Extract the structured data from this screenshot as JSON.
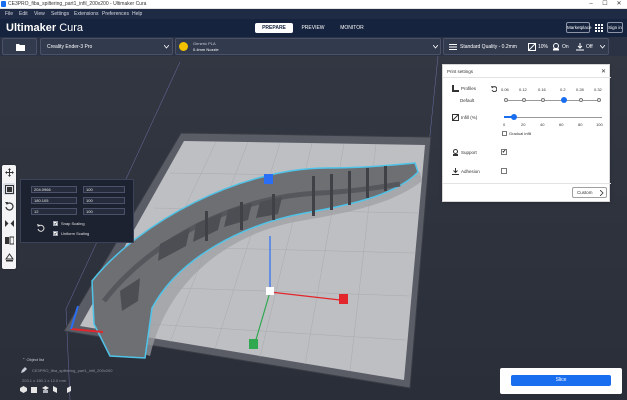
{
  "window": {
    "title": "CE3PRO_fiba_spiltering_part1_infil_200x200 - Ultimaker Cura",
    "controls": [
      "–",
      "☐",
      "✕"
    ]
  },
  "menu": [
    "File",
    "Edit",
    "View",
    "Settings",
    "Extensions",
    "Preferences",
    "Help"
  ],
  "header": {
    "logo_bold": "Ultimaker",
    "logo_light": "Cura",
    "stages": [
      "PREPARE",
      "PREVIEW",
      "MONITOR"
    ],
    "marketplace": "Marketplace",
    "signin": "Sign in"
  },
  "machine": {
    "printer": "Creality Ender-3 Pro",
    "material_brand": "Generic PLA",
    "nozzle": "0.4mm Nozzle",
    "quality": "Standard Quality - 0.2mm",
    "infill": "10%",
    "support": "On",
    "adhesion": "Off"
  },
  "move_panel": {
    "x": "204.0966",
    "x_unit": "100",
    "y": "180.105",
    "y_unit": "100",
    "z": "12",
    "z_unit": "100",
    "snap_scaling": "Snap Scaling",
    "uniform_scaling": "Uniform Scaling",
    "snap_checked": true,
    "uniform_checked": true
  },
  "print_settings": {
    "title": "Print settings",
    "profiles_label": "Profiles",
    "default_label": "Default",
    "profile_ticks": [
      "0.06",
      "0.12",
      "0.16",
      "0.2",
      "0.28",
      "0.32"
    ],
    "profile_selected": "0.2",
    "infill_label": "Infill (%)",
    "infill_ticks": [
      "0",
      "20",
      "40",
      "60",
      "80",
      "100"
    ],
    "infill_value": 10,
    "gradual_infill": "Gradual infill",
    "support_label": "Support",
    "support_checked": true,
    "adhesion_label": "Adhesion",
    "adhesion_checked": false,
    "custom_button": "Custom"
  },
  "objects": {
    "header": "Object list",
    "item": "CE3PRO_fiba_spiltering_part1_infil_200x200",
    "dims": "203.1 x 180.1 x 12.0 mm"
  },
  "slice_button": "Slice",
  "colors": {
    "accent": "#196ef0",
    "header": "#15233e",
    "menubar": "#1f2a44",
    "viewport": "#2a2e38",
    "part": "#6e6f73",
    "outline": "#4fc3e8",
    "x_axis": "#e3262b",
    "y_axis": "#2fa84f",
    "z_axis": "#2a6ef5"
  }
}
